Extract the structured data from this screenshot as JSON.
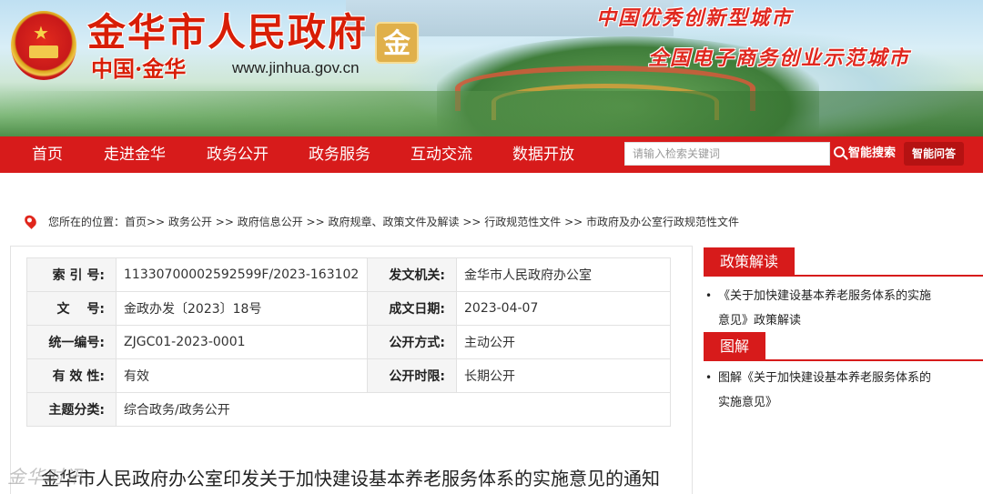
{
  "header": {
    "title": "金华市人民政府",
    "subtitle": "中国·金华",
    "url": "www.jinhua.gov.cn",
    "logo_char": "金",
    "slogan_1": "中国优秀创新型城市",
    "slogan_2": "全国电子商务创业示范城市"
  },
  "nav": {
    "items": [
      "首页",
      "走进金华",
      "政务公开",
      "政务服务",
      "互动交流",
      "数据开放"
    ],
    "search_placeholder": "请输入检索关键词",
    "search_button": "智能搜索",
    "ask_button": "智能问答"
  },
  "breadcrumb": {
    "prefix": "您所在的位置：",
    "items": [
      "首页>>",
      "政务公开 >>",
      "政府信息公开 >>",
      "政府规章、政策文件及解读 >>",
      "行政规范性文件 >>",
      "市政府及办公室行政规范性文件"
    ]
  },
  "meta": {
    "index_label": "索 引 号:",
    "index_value": "11330700002592599F/2023-163102",
    "issuer_label": "发文机关:",
    "issuer_value": "金华市人民政府办公室",
    "doc_no_label": "文　 号:",
    "doc_no_value": "金政办发〔2023〕18号",
    "date_label": "成文日期:",
    "date_value": "2023-04-07",
    "unified_label": "统一编号:",
    "unified_value": "ZJGC01-2023-0001",
    "publish_label": "公开方式:",
    "publish_value": "主动公开",
    "valid_label": "有 效 性:",
    "valid_value": "有效",
    "period_label": "公开时限:",
    "period_value": "长期公开",
    "topic_label": "主题分类:",
    "topic_value": "综合政务/政务公开"
  },
  "document": {
    "title": "金华市人民政府办公室印发关于加快建设基本养老服务体系的实施意见的通知",
    "watermark": "金华时讯"
  },
  "sidebar": {
    "section1": {
      "title": "政策解读",
      "item_line1": "《关于加快建设基本养老服务体系的实施",
      "item_line2": "意见》政策解读"
    },
    "section2": {
      "title": "图解",
      "item_line1": "图解《关于加快建设基本养老服务体系的",
      "item_line2": "实施意见》"
    }
  },
  "colors": {
    "primary_red": "#d71b1b",
    "banner_title_red": "#d81e06"
  }
}
